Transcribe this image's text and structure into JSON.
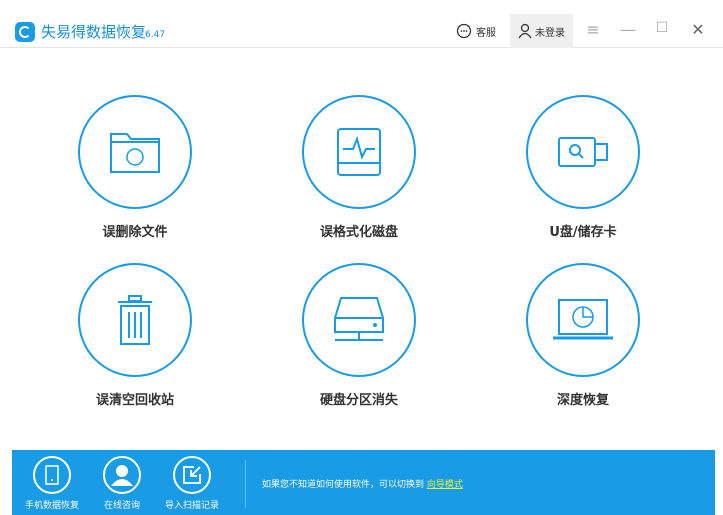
{
  "app": {
    "title": "失易得数据恢复",
    "version": "6.47"
  },
  "header": {
    "service": "客服",
    "login": "未登录"
  },
  "tiles": [
    {
      "label": "误删除文件"
    },
    {
      "label": "误格式化磁盘"
    },
    {
      "label": "U盘/储存卡"
    },
    {
      "label": "误清空回收站"
    },
    {
      "label": "硬盘分区消失"
    },
    {
      "label": "深度恢复"
    }
  ],
  "bottom": {
    "items": [
      {
        "label": "手机数据恢复"
      },
      {
        "label": "在线咨询"
      },
      {
        "label": "导入扫描记录"
      }
    ],
    "hint": "如果您不知道如何使用软件，可以切换到 ",
    "guide_link": "向导模式"
  },
  "colors": {
    "accent": "#1a9be6"
  }
}
